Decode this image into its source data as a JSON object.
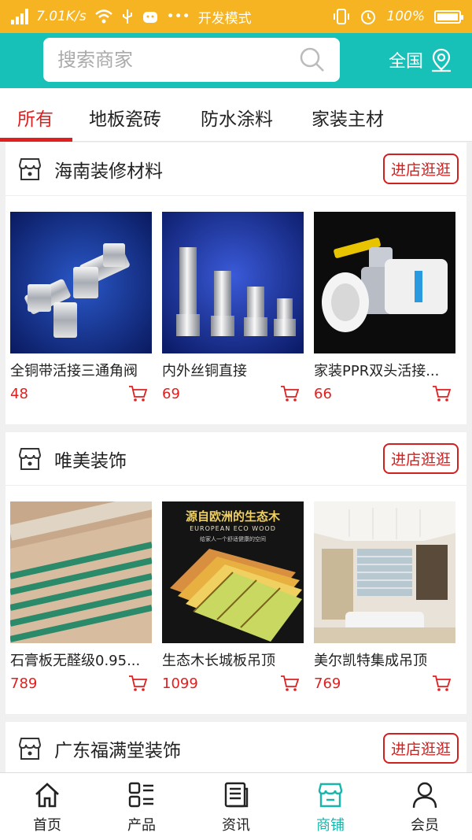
{
  "status_bar": {
    "speed": "7.01K/s",
    "dev_mode": "开发模式",
    "battery": "100%",
    "battery_level": 1.0
  },
  "search": {
    "placeholder": "搜索商家",
    "region": "全国"
  },
  "tabs": [
    {
      "label": "所有",
      "active": true
    },
    {
      "label": "地板瓷砖",
      "active": false
    },
    {
      "label": "防水涂料",
      "active": false
    },
    {
      "label": "家装主材",
      "active": false
    }
  ],
  "shops": [
    {
      "name": "海南装修材料",
      "button": "进店逛逛",
      "products": [
        {
          "name": "全铜带活接三通角阀",
          "price": "48"
        },
        {
          "name": "内外丝铜直接",
          "price": "69"
        },
        {
          "name": "家装PPR双头活接...",
          "price": "66"
        }
      ]
    },
    {
      "name": "唯美装饰",
      "button": "进店逛逛",
      "products": [
        {
          "name": "石膏板无醛级0.95...",
          "price": "789"
        },
        {
          "name": "生态木长城板吊顶",
          "price": "1099"
        },
        {
          "name": "美尔凯特集成吊顶",
          "price": "769"
        }
      ]
    },
    {
      "name": "广东福满堂装饰",
      "button": "进店逛逛"
    }
  ],
  "image_texts": {
    "eco_wood_title": "源自欧洲的生态木",
    "eco_wood_en": "EUROPEAN ECO WOOD",
    "eco_wood_sub": "给家人一个舒适健康的空间"
  },
  "tabbar": [
    {
      "label": "首页",
      "icon": "home-icon",
      "active": false
    },
    {
      "label": "产品",
      "icon": "products-icon",
      "active": false
    },
    {
      "label": "资讯",
      "icon": "news-icon",
      "active": false
    },
    {
      "label": "商铺",
      "icon": "shop-icon",
      "active": true
    },
    {
      "label": "会员",
      "icon": "user-icon",
      "active": false
    }
  ],
  "colors": {
    "status": "#f6b422",
    "accent": "#17c1b7",
    "price": "#e02020",
    "tab_active": "#17b5ab"
  }
}
